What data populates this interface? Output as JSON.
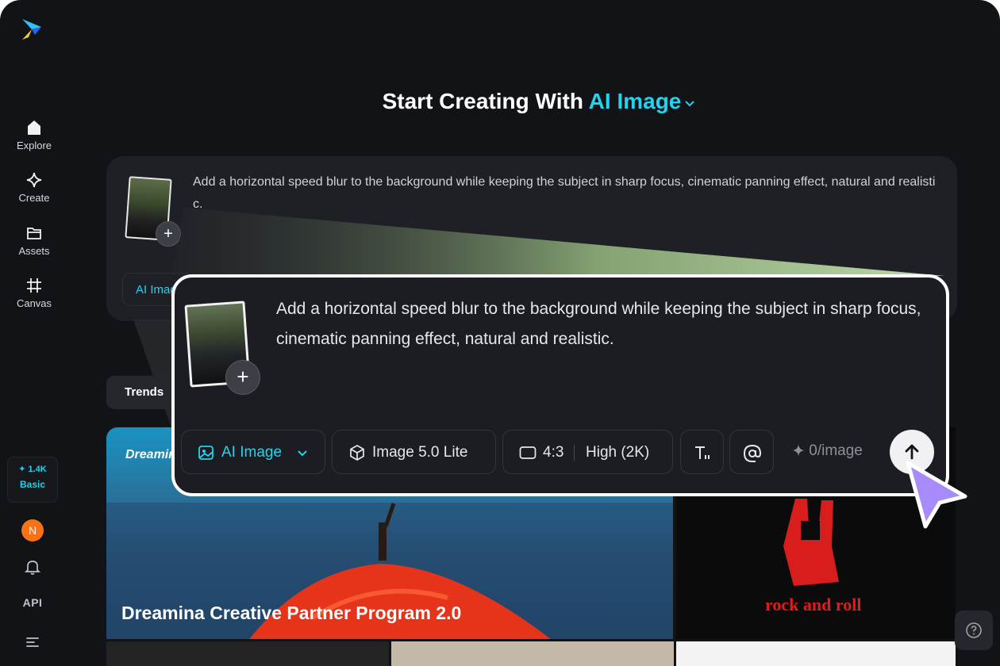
{
  "sidebar": {
    "items": [
      {
        "label": "Explore",
        "icon": "home-icon"
      },
      {
        "label": "Create",
        "icon": "sparkle-icon"
      },
      {
        "label": "Assets",
        "icon": "folder-icon"
      },
      {
        "label": "Canvas",
        "icon": "frame-icon"
      }
    ],
    "credits": {
      "amount": "✦ 1.4K",
      "plan": "Basic"
    },
    "avatar_initial": "N",
    "api_label": "API"
  },
  "header": {
    "prefix": "Start Creating With",
    "mode": "AI Image"
  },
  "prompt_card": {
    "text": "Add a horizontal speed blur to the background while keeping the subject in sharp focus, cinematic panning effect, natural and realistic.",
    "mode_label": "AI Image"
  },
  "trends_label": "Trends",
  "gallery": {
    "banner_logo": "Dreamina",
    "banner_title": "Dreamina Creative Partner Program 2.0",
    "rock_text": "rock and roll"
  },
  "zoom": {
    "prompt": "Add a horizontal speed blur to the background while keeping the subject in sharp focus, cinematic panning effect, natural and realistic.",
    "mode_label": "AI Image",
    "model_label": "Image 5.0 Lite",
    "ratio_label": "4:3",
    "quality_label": "High (2K)",
    "cost_label": "0/image"
  },
  "colors": {
    "accent": "#22d3ee",
    "background": "#121317",
    "card": "#1f2026",
    "avatar": "#f97316",
    "highlight_border": "#ffffff",
    "cursor": "#a78bfa"
  }
}
